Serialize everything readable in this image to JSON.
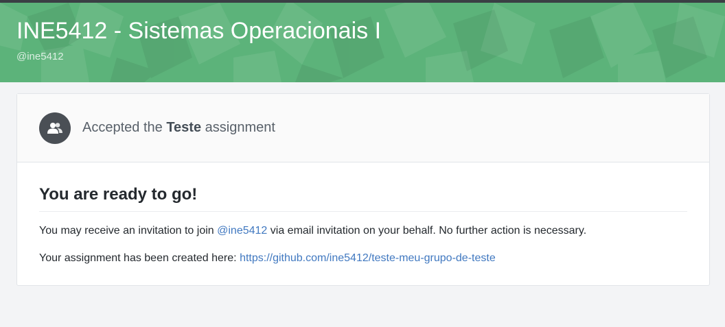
{
  "header": {
    "title": "INE5412 - Sistemas Operacionais I",
    "handle": "@ine5412",
    "background_color": "#5cb37a"
  },
  "card": {
    "icon": "people-icon",
    "accepted_prefix": "Accepted the",
    "assignment_name": "Teste",
    "accepted_suffix": "assignment",
    "ready_title": "You are ready to go!",
    "invite_prefix": "You may receive an invitation to join",
    "invite_org_link": "@ine5412",
    "invite_suffix": "via email invitation on your behalf. No further action is necessary.",
    "repo_prefix": "Your assignment has been created here:",
    "repo_link": "https://github.com/ine5412/teste-meu-grupo-de-teste"
  },
  "colors": {
    "link": "#4078c0",
    "avatar_bg": "#4a4f55"
  }
}
